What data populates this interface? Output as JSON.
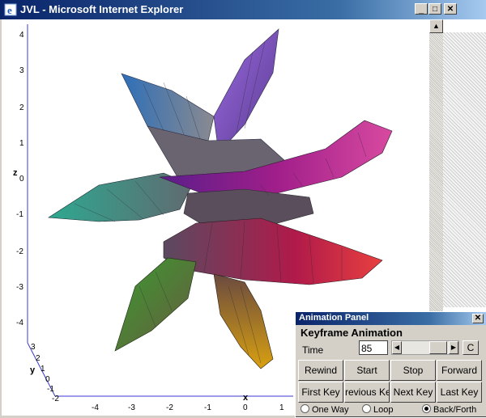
{
  "window": {
    "title": "JVL - Microsoft Internet Explorer",
    "minimize": "_",
    "maximize": "□",
    "close": "✕"
  },
  "plot": {
    "z_axis_label": "z",
    "z_ticks": [
      "4",
      "3",
      "2",
      "1",
      "0",
      "-1",
      "-2",
      "-3",
      "-4"
    ],
    "y_axis_label": "y",
    "y_ticks": [
      "3",
      "2",
      "1",
      "0",
      "-1",
      "-2"
    ],
    "x_axis_label": "x",
    "x_ticks": [
      "-4",
      "-3",
      "-2",
      "-1",
      "0",
      "1"
    ]
  },
  "panel": {
    "title": "Animation Panel",
    "close": "✕",
    "heading": "Keyframe Animation",
    "time_label": "Time",
    "time_value": "85",
    "c_button": "C",
    "buttons_row1": [
      "Rewind",
      "Start",
      "Stop",
      "Forward"
    ],
    "buttons_row2": [
      "First Key",
      "revious Ke",
      "Next Key",
      "Last Key"
    ],
    "radio_one_way": "One Way",
    "radio_loop": "Loop",
    "radio_back_forth": "Back/Forth",
    "selected_mode": "Back/Forth"
  }
}
